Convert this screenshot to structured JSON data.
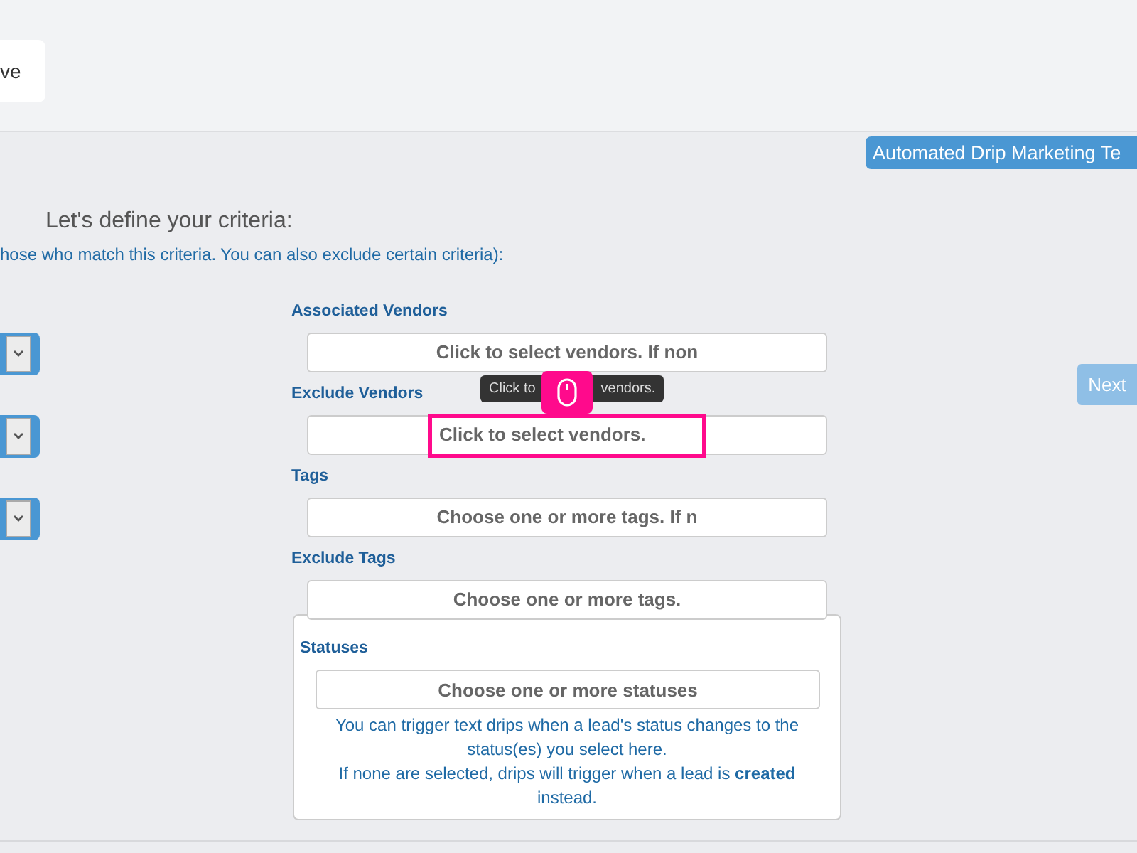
{
  "top_bar": {
    "button_text": "ve"
  },
  "template_pill": "Automated Drip Marketing Te",
  "heading": "Let's define your criteria:",
  "subtitle": "hose who match this criteria. You can also exclude certain criteria):",
  "next_button": {
    "label": "Next",
    "disabled": true
  },
  "criteria": [
    {
      "label": "Associated Vendors",
      "placeholder": "Click to select vendors. If non",
      "side_dropdown": true,
      "highlighted": false
    },
    {
      "label": "Exclude Vendors",
      "placeholder": "Click to select vendors.",
      "side_dropdown": true,
      "highlighted": true,
      "tooltip": [
        "Click to",
        "vendors."
      ]
    },
    {
      "label": "Tags",
      "placeholder": "Choose one or more tags. If n",
      "side_dropdown": true,
      "highlighted": false
    },
    {
      "label": "Exclude Tags",
      "placeholder": "Choose one or more tags.",
      "side_dropdown": false,
      "highlighted": false
    }
  ],
  "statuses": {
    "label": "Statuses",
    "placeholder": "Choose one or more statuses",
    "help": [
      "You can trigger text drips when a lead's status changes to the status(es) you select here.",
      "If none are selected, drips will trigger when a lead is **created** instead."
    ]
  }
}
